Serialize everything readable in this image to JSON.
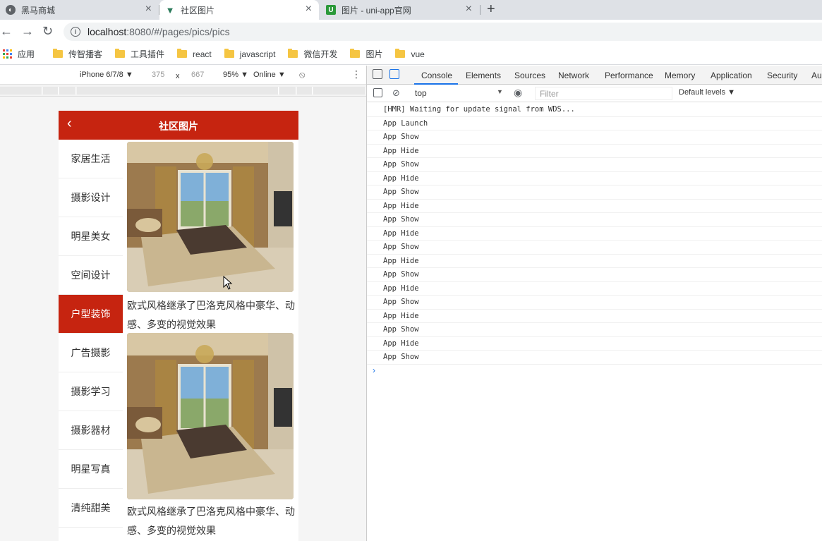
{
  "tabs": [
    {
      "title": "黑马商城",
      "icon": "globe-icon"
    },
    {
      "title": "社区图片",
      "icon": "vue-icon"
    },
    {
      "title": "图片 - uni-app官网",
      "icon": "uniapp-icon"
    }
  ],
  "address": {
    "host": "localhost",
    "path": ":8080/#/pages/pics/pics"
  },
  "bookmarks": {
    "apps": "应用",
    "folders": [
      "传智播客",
      "工具插件",
      "react",
      "javascript",
      "微信开发",
      "图片",
      "vue"
    ]
  },
  "device_toolbar": {
    "device": "iPhone 6/7/8 ▼",
    "width": "375",
    "times": "x",
    "height": "667",
    "zoom": "95% ▼",
    "network": "Online ▼"
  },
  "app": {
    "title": "社区图片",
    "categories": [
      "家居生活",
      "摄影设计",
      "明星美女",
      "空间设计",
      "户型装饰",
      "广告摄影",
      "摄影学习",
      "摄影器材",
      "明星写真",
      "清纯甜美"
    ],
    "selected_category": "户型装饰",
    "items": [
      {
        "desc": "欧式风格继承了巴洛克风格中豪华、动感、多变的视觉效果"
      },
      {
        "desc": "欧式风格继承了巴洛克风格中豪华、动感、多变的视觉效果"
      }
    ],
    "brand_color": "#c62410"
  },
  "devtools": {
    "tabs": [
      "Console",
      "Elements",
      "Sources",
      "Network",
      "Performance",
      "Memory",
      "Application",
      "Security",
      "Au"
    ],
    "active_tab": "Console",
    "context": "top",
    "filter_placeholder": "Filter",
    "levels": "Default levels ▼",
    "logs": [
      "[HMR] Waiting for update signal from WDS...",
      "App Launch",
      "App Show",
      "App Hide",
      "App Show",
      "App Hide",
      "App Show",
      "App Hide",
      "App Show",
      "App Hide",
      "App Show",
      "App Hide",
      "App Show",
      "App Hide",
      "App Show",
      "App Hide",
      "App Show",
      "App Hide",
      "App Show"
    ],
    "prompt": "›"
  }
}
